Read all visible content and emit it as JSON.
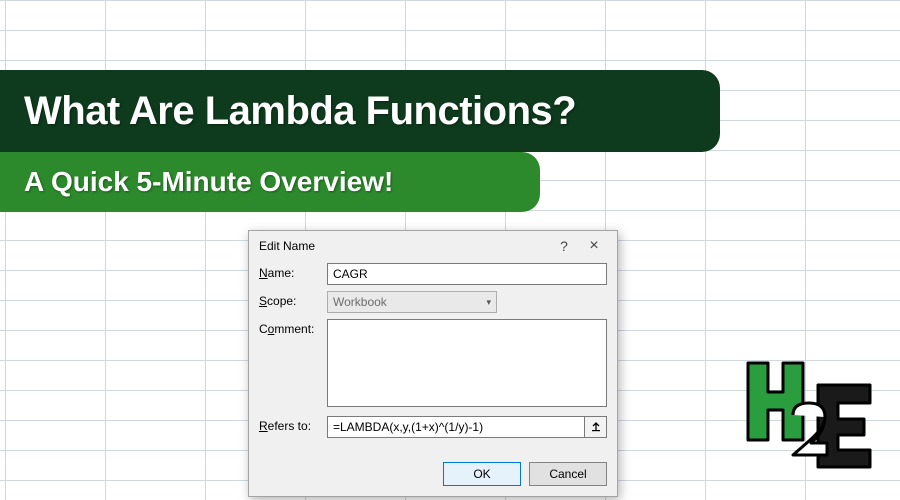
{
  "banner": {
    "title": "What Are Lambda Functions?",
    "subtitle": "A Quick 5-Minute Overview!"
  },
  "dialog": {
    "title": "Edit Name",
    "labels": {
      "name": "Name:",
      "scope": "Scope:",
      "comment": "Comment:",
      "refers": "Refers to:"
    },
    "fields": {
      "name_value": "CAGR",
      "scope_value": "Workbook",
      "comment_value": "",
      "refers_value": "=LAMBDA(x,y,(1+x)^(1/y)-1)"
    },
    "buttons": {
      "ok": "OK",
      "cancel": "Cancel"
    }
  },
  "logo": {
    "name": "H2E"
  }
}
